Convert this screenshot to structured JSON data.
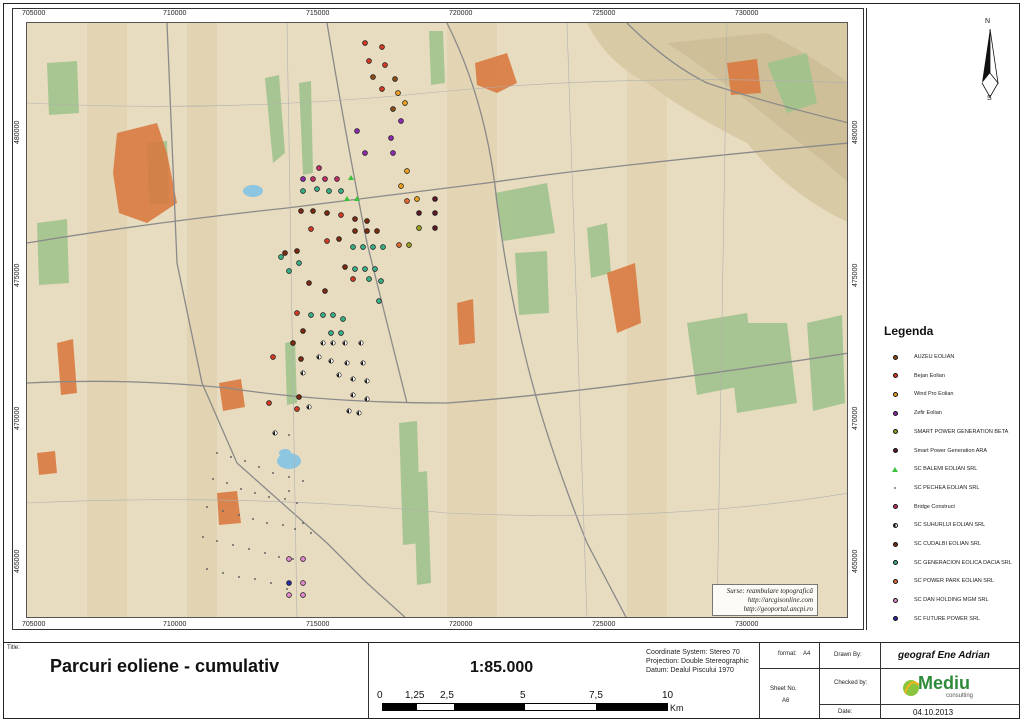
{
  "map": {
    "top_ticks": [
      "705000",
      "710000",
      "715000",
      "720000",
      "725000",
      "730000"
    ],
    "bottom_ticks": [
      "705000",
      "710000",
      "715000",
      "720000",
      "725000",
      "730000"
    ],
    "left_ticks": [
      "480000",
      "475000",
      "470000",
      "465000"
    ],
    "right_ticks": [
      "480000",
      "475000",
      "470000",
      "465000"
    ],
    "attribution": [
      "Surse: reambulare topografică",
      "http://arcgisonline.com",
      "http://geoportal.ancpi.ro"
    ],
    "north_arrow": {
      "n": "N",
      "s": "S"
    }
  },
  "legend": {
    "title": "Legenda",
    "items": [
      {
        "label": "AUZEU EOLIAN",
        "color": "#8a4b1a",
        "shape": "dot"
      },
      {
        "label": "Bejan Eolian",
        "color": "#d23a22",
        "shape": "dot"
      },
      {
        "label": "Wind Pro Eolian",
        "color": "#f0a020",
        "shape": "dot"
      },
      {
        "label": "Zefir Eolian",
        "color": "#8a2bb0",
        "shape": "dot"
      },
      {
        "label": "SMART POWER GENERATION BETA",
        "color": "#9aa020",
        "shape": "dot"
      },
      {
        "label": "Smart Power Generation ARA",
        "color": "#5a1a2a",
        "shape": "dot"
      },
      {
        "label": "SC BALEMI EOLIAN SRL",
        "color": "#3cc23c",
        "shape": "triangle"
      },
      {
        "label": "SC PECHEA EOLIAN SRL",
        "color": "#777777",
        "shape": "small"
      },
      {
        "label": "Bridge Construct",
        "color": "#c0306a",
        "shape": "dot"
      },
      {
        "label": "SC SUHURLUI EOLIAN SRL",
        "color": "#111111",
        "shape": "half"
      },
      {
        "label": "SC CUDALBI EOLIAN SRL",
        "color": "#7a2a10",
        "shape": "dot"
      },
      {
        "label": "SC GENERACION EOLICA DACIA SRL",
        "color": "#3ab08a",
        "shape": "dot"
      },
      {
        "label": "SC POWER PARK EOLIAN SRL",
        "color": "#e06a30",
        "shape": "dot"
      },
      {
        "label": "SC DAN HOLDING MGM SRL",
        "color": "#e08ad0",
        "shape": "dot"
      },
      {
        "label": "SC FUTURE POWER SRL",
        "color": "#2a2aa0",
        "shape": "dot"
      }
    ]
  },
  "title_block": {
    "title_label": "Title:",
    "title": "Parcuri eoliene - cumulativ",
    "scale": "1:85.000",
    "scale_bar_labels": [
      "0",
      "1,25",
      "2,5",
      "5",
      "7,5",
      "10"
    ],
    "scale_bar_unit": "Km",
    "coordinate_system": "Coordinate System: Stereo 70",
    "projection": "Projection: Double Stereographic",
    "datum": "Datum: Dealul Piscului 1970",
    "format_label": "format:",
    "format_value": "A4",
    "sheet_label": "Sheet No.",
    "sheet_value": "A6",
    "drawn_by_label": "Drawn By:",
    "drawn_by": "geograf Ene Adrian",
    "checked_by_label": "Checked by:",
    "logo_text": "Mediu",
    "logo_sub": "consulting",
    "date_label": "Date:",
    "date": "04.10.2013"
  }
}
